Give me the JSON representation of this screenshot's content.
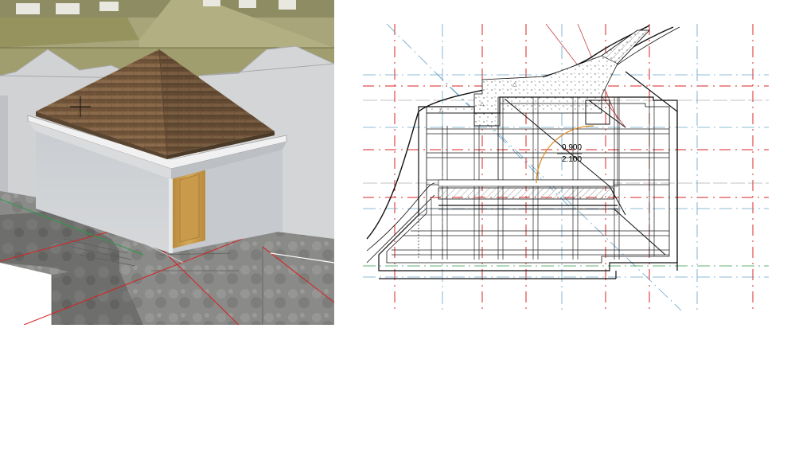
{
  "door": {
    "width_label": "0.900",
    "height_label": "2.100"
  },
  "colors": {
    "roof": "#7a5c40",
    "wall": "#cfd2d6",
    "door": "#c99a4a",
    "stone": "#8a8a88",
    "grid_red": "#d82020",
    "grid_blue": "#6aa5c8",
    "door_swing": "#e08a20"
  },
  "icons": {
    "cursor": "crosshair-icon"
  }
}
